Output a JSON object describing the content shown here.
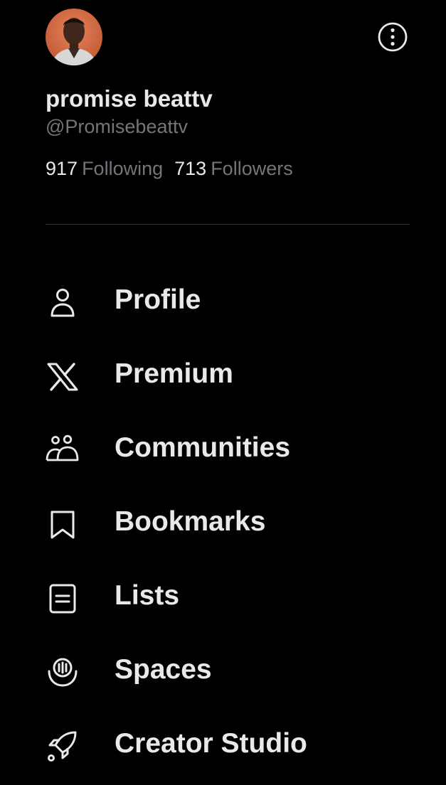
{
  "profile": {
    "display_name": "promise beattv",
    "handle": "@Promisebeattv",
    "following_count": "917",
    "following_label": "Following",
    "followers_count": "713",
    "followers_label": "Followers"
  },
  "header_icons": {
    "avatar": "profile-photo",
    "more": "more-options-icon"
  },
  "menu": {
    "items": [
      {
        "label": "Profile",
        "icon": "person-icon"
      },
      {
        "label": "Premium",
        "icon": "x-logo-icon"
      },
      {
        "label": "Communities",
        "icon": "communities-icon"
      },
      {
        "label": "Bookmarks",
        "icon": "bookmark-icon"
      },
      {
        "label": "Lists",
        "icon": "list-icon"
      },
      {
        "label": "Spaces",
        "icon": "spaces-icon"
      },
      {
        "label": "Creator Studio",
        "icon": "rocket-icon"
      }
    ]
  },
  "colors": {
    "background": "#000000",
    "primary_text": "#e7e9ea",
    "secondary_text": "#71767b",
    "divider": "#2f3336"
  }
}
